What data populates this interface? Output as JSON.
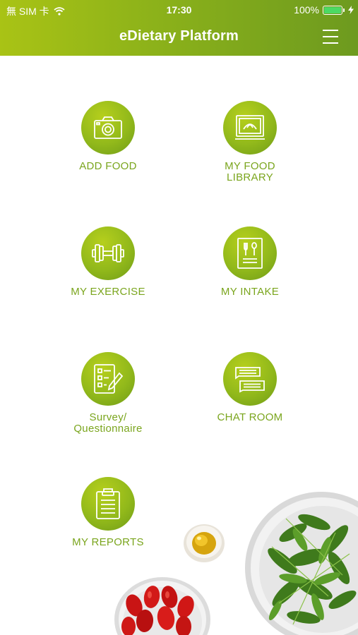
{
  "status_bar": {
    "carrier": "無 SIM 卡",
    "time": "17:30",
    "battery_text": "100%",
    "battery_level": 1.0,
    "icons": [
      "wifi-icon",
      "battery-icon",
      "charging-icon"
    ]
  },
  "header": {
    "title": "eDietary Platform",
    "menu_icon": "hamburger-menu-icon"
  },
  "colors": {
    "header_start": "#a9c315",
    "header_end": "#6d9a1f",
    "tile_green": "#92b91b",
    "label_green": "#7aa51d"
  },
  "tiles": [
    {
      "label": "ADD FOOD",
      "icon": "camera-icon"
    },
    {
      "label": "MY FOOD\nLIBRARY",
      "icon": "food-library-icon"
    },
    {
      "label": "MY EXERCISE",
      "icon": "dumbbell-icon"
    },
    {
      "label": "MY INTAKE",
      "icon": "intake-menu-icon"
    },
    {
      "label": "Survey/\nQuestionnaire",
      "icon": "checklist-icon"
    },
    {
      "label": "CHAT ROOM",
      "icon": "chat-bubbles-icon"
    },
    {
      "label": "MY REPORTS",
      "icon": "clipboard-icon"
    }
  ]
}
